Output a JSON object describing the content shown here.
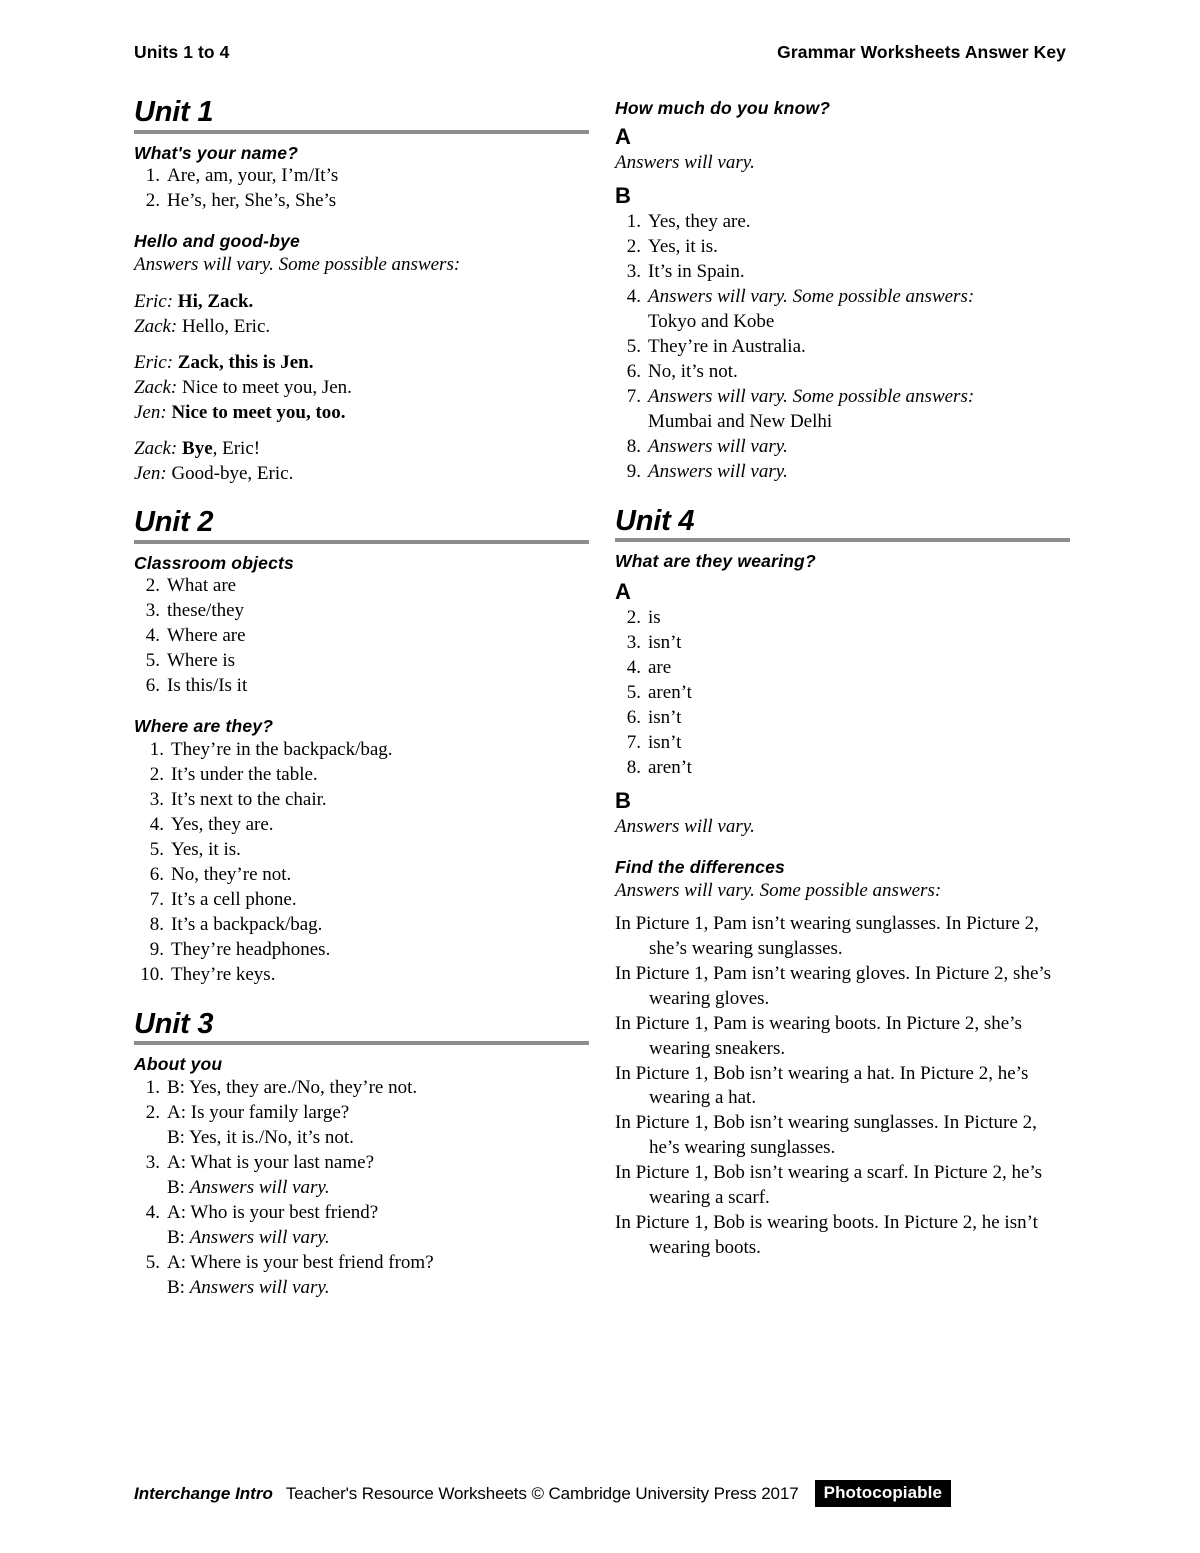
{
  "header": {
    "left": "Units 1 to 4",
    "right": "Grammar Worksheets Answer Key"
  },
  "footer": {
    "title": "Interchange Intro",
    "text": "Teacher's Resource Worksheets © Cambridge University Press 2017",
    "badge": "Photocopiable"
  },
  "left_column": {
    "unit1": {
      "heading": "Unit 1",
      "sections": {
        "whats_your_name": {
          "heading": "What's your name?",
          "items": [
            {
              "num": "1.",
              "text": "Are, am, your, I’m/It’s"
            },
            {
              "num": "2.",
              "text": "He’s, her, She’s, She’s"
            }
          ]
        },
        "hello_goodbye": {
          "heading": "Hello and good-bye",
          "note": "Answers will vary. Some possible answers:",
          "dialogues": [
            [
              {
                "who": "Eric:",
                "said": "Hi, Zack.",
                "bold": true
              },
              {
                "who": "Zack:",
                "said": "Hello, Eric.",
                "bold": false
              }
            ],
            [
              {
                "who": "Eric:",
                "said": "Zack, this is Jen.",
                "bold": true
              },
              {
                "who": "Zack:",
                "said": "Nice to meet you, Jen.",
                "bold": false
              },
              {
                "who": "Jen:",
                "said": "Nice to meet you, too.",
                "bold": true
              }
            ],
            [
              {
                "who": "Zack:",
                "said": "Bye",
                "tail": ", Eric!",
                "bold": true
              },
              {
                "who": "Jen:",
                "said": "Good-bye, Eric.",
                "bold": false
              }
            ]
          ]
        }
      }
    },
    "unit2": {
      "heading": "Unit 2",
      "sections": {
        "classroom_objects": {
          "heading": "Classroom objects",
          "items": [
            {
              "num": "2.",
              "text": "What are"
            },
            {
              "num": "3.",
              "text": "these/they"
            },
            {
              "num": "4.",
              "text": "Where are"
            },
            {
              "num": "5.",
              "text": "Where is"
            },
            {
              "num": "6.",
              "text": "Is this/Is it"
            }
          ]
        },
        "where_are_they": {
          "heading": "Where are they?",
          "items": [
            {
              "num": "1.",
              "text": "They’re in the backpack/bag."
            },
            {
              "num": "2.",
              "text": "It’s under the table."
            },
            {
              "num": "3.",
              "text": "It’s next to the chair."
            },
            {
              "num": "4.",
              "text": "Yes, they are."
            },
            {
              "num": "5.",
              "text": "Yes, it is."
            },
            {
              "num": "6.",
              "text": "No, they’re not."
            },
            {
              "num": "7.",
              "text": "It’s a cell phone."
            },
            {
              "num": "8.",
              "text": "It’s a backpack/bag."
            },
            {
              "num": "9.",
              "text": "They’re headphones."
            },
            {
              "num": "10.",
              "text": "They’re keys."
            }
          ]
        }
      }
    },
    "unit3": {
      "heading": "Unit 3",
      "sections": {
        "about_you": {
          "heading": "About you",
          "items": [
            {
              "num": "1.",
              "line1": "B: Yes, they are./No, they’re not.",
              "line1_italic": false
            },
            {
              "num": "2.",
              "line1": "A: Is your family large?",
              "line2": "B: Yes, it is./No, it’s not.",
              "line2_italic": false
            },
            {
              "num": "3.",
              "line1": "A: What is your last name?",
              "line2_prefix": "B: ",
              "line2_italic_text": "Answers will vary."
            },
            {
              "num": "4.",
              "line1": "A: Who is your best friend?",
              "line2_prefix": "B: ",
              "line2_italic_text": "Answers will vary."
            },
            {
              "num": "5.",
              "line1": "A: Where is your best friend from?",
              "line2_prefix": "B: ",
              "line2_italic_text": "Answers will vary."
            }
          ]
        }
      }
    }
  },
  "right_column": {
    "how_much": {
      "heading": "How much do you know?",
      "part_a": {
        "letter": "A",
        "note": "Answers will vary."
      },
      "part_b": {
        "letter": "B",
        "items": [
          {
            "num": "1.",
            "text": "Yes, they are.",
            "italic": false
          },
          {
            "num": "2.",
            "text": "Yes, it is.",
            "italic": false
          },
          {
            "num": "3.",
            "text": "It’s in Spain.",
            "italic": false
          },
          {
            "num": "4.",
            "text": "Answers will vary. Some possible answers:",
            "italic": true,
            "sub": "Tokyo and Kobe"
          },
          {
            "num": "5.",
            "text": "They’re in Australia.",
            "italic": false
          },
          {
            "num": "6.",
            "text": "No, it’s not.",
            "italic": false
          },
          {
            "num": "7.",
            "text": "Answers will vary. Some possible answers:",
            "italic": true,
            "sub": "Mumbai and New Delhi"
          },
          {
            "num": "8.",
            "text": "Answers will vary.",
            "italic": true
          },
          {
            "num": "9.",
            "text": "Answers will vary.",
            "italic": true
          }
        ]
      }
    },
    "unit4": {
      "heading": "Unit 4",
      "sections": {
        "what_are_they_wearing": {
          "heading": "What are they wearing?",
          "part_a": {
            "letter": "A",
            "items": [
              {
                "num": "2.",
                "text": "is"
              },
              {
                "num": "3.",
                "text": "isn’t"
              },
              {
                "num": "4.",
                "text": "are"
              },
              {
                "num": "5.",
                "text": "aren’t"
              },
              {
                "num": "6.",
                "text": "isn’t"
              },
              {
                "num": "7.",
                "text": "isn’t"
              },
              {
                "num": "8.",
                "text": "aren’t"
              }
            ]
          },
          "part_b": {
            "letter": "B",
            "note": "Answers will vary."
          }
        },
        "find_the_differences": {
          "heading": "Find the differences",
          "note": "Answers will vary. Some possible answers:",
          "items": [
            "In Picture 1, Pam isn’t wearing sunglasses. In Picture 2, she’s wearing sunglasses.",
            "In Picture 1, Pam isn’t wearing gloves. In Picture 2, she’s wearing gloves.",
            "In Picture 1, Pam is wearing boots. In Picture 2, she’s wearing sneakers.",
            "In Picture 1, Bob isn’t wearing a hat. In Picture 2, he’s wearing a hat.",
            "In Picture 1, Bob isn’t wearing sunglasses. In Picture 2, he’s wearing sunglasses.",
            "In Picture 1, Bob isn’t wearing a scarf. In Picture 2, he’s wearing a scarf.",
            "In Picture 1, Bob is wearing boots. In Picture 2, he isn’t wearing boots."
          ]
        }
      }
    }
  }
}
